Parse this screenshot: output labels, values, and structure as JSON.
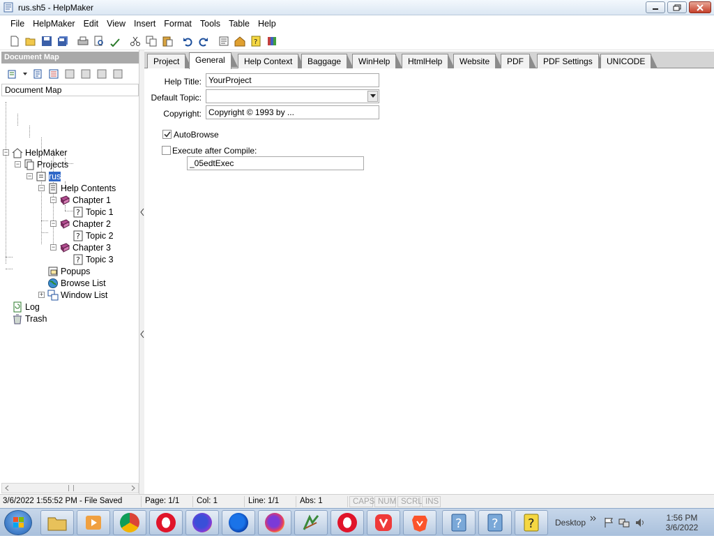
{
  "window": {
    "title": "rus.sh5 - HelpMaker",
    "buttons": [
      "minimize-icon",
      "maximize-icon",
      "close-icon"
    ]
  },
  "menu": [
    {
      "label": "File",
      "key": "F"
    },
    {
      "label": "HelpMaker",
      "key": "H"
    },
    {
      "label": "Edit",
      "key": "E"
    },
    {
      "label": "View",
      "key": "V"
    },
    {
      "label": "Insert",
      "key": "I"
    },
    {
      "label": "Format",
      "key": "F"
    },
    {
      "label": "Tools",
      "key": "T"
    },
    {
      "label": "Table",
      "key": "a"
    },
    {
      "label": "Help",
      "key": "H"
    }
  ],
  "toolbar_icons": [
    "new-icon",
    "open-icon",
    "save-icon",
    "save-all-icon",
    "print-icon",
    "print-preview-icon",
    "spellcheck-icon",
    "cut-icon",
    "copy-icon",
    "paste-icon",
    "undo-icon",
    "redo-icon",
    "topic-properties-icon",
    "compile-icon",
    "help-icon",
    "books-icon"
  ],
  "left_pane": {
    "title": "Document Map",
    "header": "Document Map",
    "tools": [
      "add-topic-icon",
      "add-child-icon",
      "topic-list-icon",
      "move-first-icon",
      "move-last-icon",
      "move-up-icon",
      "move-down-icon"
    ],
    "tree": [
      {
        "label": "HelpMaker",
        "icon": "home-icon"
      },
      {
        "label": "Projects",
        "icon": "projects-icon"
      },
      {
        "label": "rus",
        "icon": "project-icon"
      },
      {
        "label": "Help Contents",
        "icon": "contents-icon"
      },
      {
        "label": "Chapter 1",
        "icon": "book-icon"
      },
      {
        "label": "Topic 1",
        "icon": "topic-icon"
      },
      {
        "label": "Chapter 2",
        "icon": "book-icon"
      },
      {
        "label": "Topic 2",
        "icon": "topic-icon"
      },
      {
        "label": "Chapter 3",
        "icon": "book-icon"
      },
      {
        "label": "Topic 3",
        "icon": "topic-icon"
      },
      {
        "label": "Popups",
        "icon": "popups-icon"
      },
      {
        "label": "Browse List",
        "icon": "globe-icon"
      },
      {
        "label": "Window List",
        "icon": "windows-icon"
      },
      {
        "label": "Log",
        "icon": "log-icon"
      },
      {
        "label": "Trash",
        "icon": "trash-icon"
      }
    ]
  },
  "tabs": [
    "Project",
    "General",
    "Help Context",
    "Baggage",
    "WinHelp",
    "HtmlHelp",
    "Website",
    "PDF",
    "PDF Settings",
    "UNICODE"
  ],
  "active_tab": "General",
  "form": {
    "help_title_label": "Help Title:",
    "help_title_value": "YourProject",
    "default_topic_label": "Default Topic:",
    "default_topic_value": "",
    "copyright_label": "Copyright:",
    "copyright_value": "Copyright © 1993 by ...",
    "autobrowse_label": "AutoBrowse",
    "autobrowse_checked": true,
    "execute_label": "Execute after Compile:",
    "execute_checked": false,
    "execute_value": "_05edtExec"
  },
  "status": {
    "saved": "3/6/2022 1:55:52 PM - File Saved",
    "page": "Page: 1/1",
    "col": "Col: 1",
    "line": "Line: 1/1",
    "abs": "Abs: 1",
    "caps": "CAPS",
    "num": "NUM",
    "scrl": "SCRL",
    "ins": "INS"
  },
  "taskbar": {
    "apps": [
      "explorer-icon",
      "media-player-icon",
      "chrome-icon",
      "opera-icon",
      "firefox-icon",
      "firefox-icon",
      "firefox-icon",
      "app-icon",
      "opera-icon",
      "vivaldi-icon",
      "brave-icon",
      "help-icon",
      "help-icon",
      "help-icon"
    ],
    "desktop_label": "Desktop",
    "time": "1:56 PM",
    "date": "3/6/2022"
  }
}
